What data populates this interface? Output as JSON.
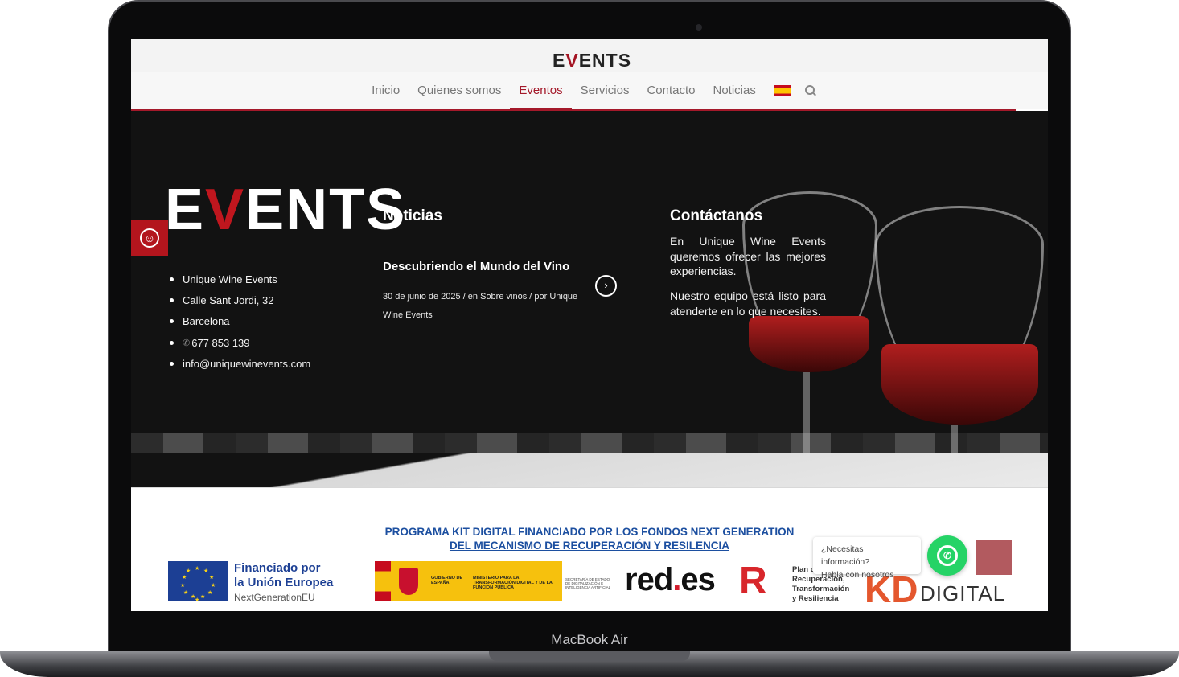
{
  "device": {
    "label": "MacBook Air"
  },
  "header": {
    "logo": {
      "pre": "E",
      "v": "V",
      "post": "ENTS"
    },
    "nav": [
      {
        "label": "Inicio"
      },
      {
        "label": "Quienes somos"
      },
      {
        "label": "Eventos",
        "active": true
      },
      {
        "label": "Servicios"
      },
      {
        "label": "Contacto"
      },
      {
        "label": "Noticias"
      }
    ],
    "language_icon": "spain-flag-icon",
    "search_icon": "search-icon"
  },
  "footer": {
    "logo": {
      "pre": "E",
      "v": "V",
      "post": "ENTS"
    },
    "accessibility_icon": "accessibility-icon",
    "info": [
      "Unique Wine Events",
      "Calle Sant Jordi, 32",
      "Barcelona",
      "677 853 139",
      "info@uniquewinevents.com"
    ],
    "news": {
      "heading": "Noticias",
      "title": "Descubriendo el Mundo del Vino",
      "meta": "30 de junio de 2025  /  en Sobre vinos  /  por Unique Wine Events",
      "arrow_icon": "chevron-right-icon"
    },
    "contact": {
      "heading": "Contáctanos",
      "p1": "En Unique Wine Events queremos ofrecer las mejores experiencias.",
      "p2": "Nuestro equipo está listo para atenderte en lo que necesites."
    }
  },
  "kit_digital": {
    "heading_line1": "PROGRAMA KIT DIGITAL FINANCIADO POR LOS FONDOS NEXT GENERATION",
    "heading_line2": "DEL MECANISMO DE RECUPERACIÓN Y RESILENCIA",
    "eu": {
      "line1": "Financiado por",
      "line2": "la Unión Europea",
      "line3": "NextGenerationEU"
    },
    "gobierno": {
      "a": "GOBIERNO DE ESPAÑA",
      "b": "MINISTERIO PARA LA TRANSFORMACIÓN DIGITAL Y DE LA FUNCIÓN PÚBLICA",
      "c": "SECRETARÍA DE ESTADO DE DIGITALIZACIÓN E INTELIGENCIA ARTIFICIAL"
    },
    "redes": {
      "pre": "red",
      "dot": ".",
      "post": "es"
    },
    "prtr": {
      "line1": "Plan de",
      "line2": "Recuperación,",
      "line3": "Transformación",
      "line4": "y Resiliencia"
    },
    "kd": {
      "k": "KD",
      "digital": "DIGITAL"
    }
  },
  "chat": {
    "line1": "¿Necesitas información?",
    "line2": "Habla con nosotros",
    "icon": "whatsapp-icon"
  },
  "colors": {
    "accent": "#a4192a",
    "dark_bg": "#121212",
    "whatsapp": "#25d366",
    "kit_blue": "#1c4fa0"
  }
}
